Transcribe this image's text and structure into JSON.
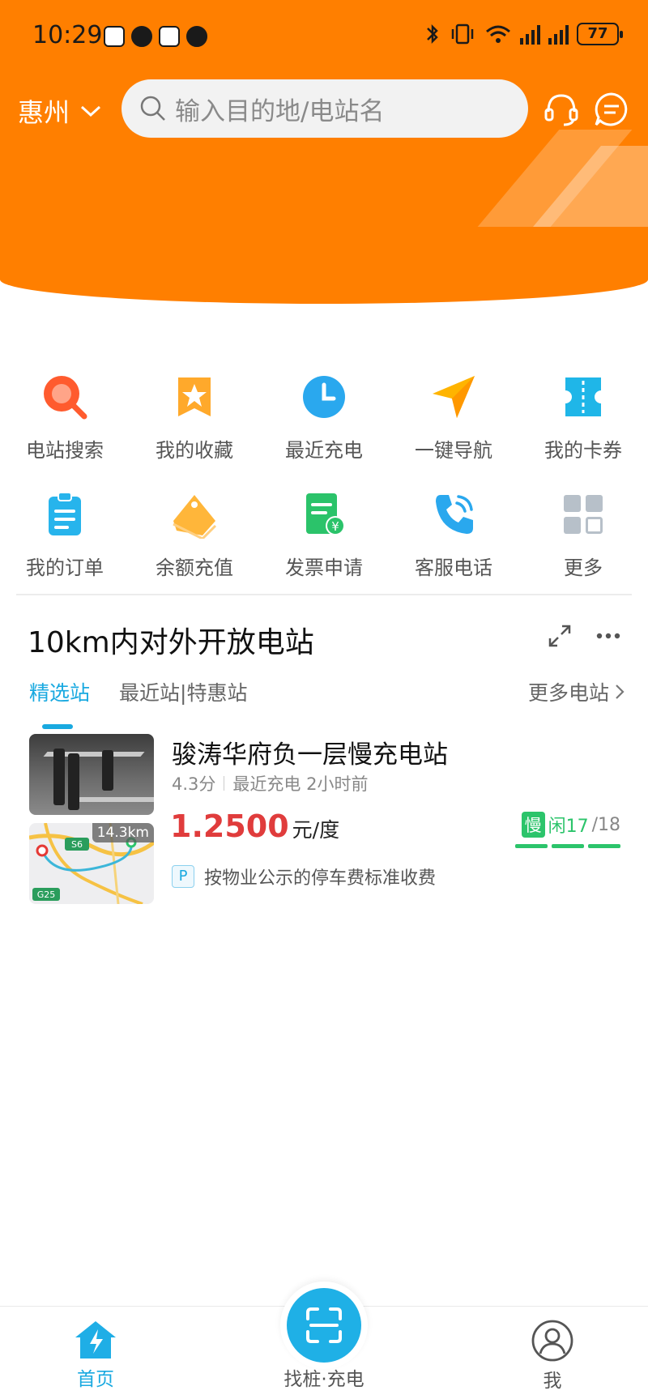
{
  "status_bar": {
    "time": "10:29",
    "battery": "77"
  },
  "header": {
    "city": "惠州",
    "search_placeholder": "输入目的地/电站名"
  },
  "quick_menu": [
    {
      "label": "电站搜索",
      "icon": "search-icon",
      "color": "#ff5b2e"
    },
    {
      "label": "我的收藏",
      "icon": "star-icon",
      "color": "#ffa92b"
    },
    {
      "label": "最近充电",
      "icon": "clock-icon",
      "color": "#2aa8ee"
    },
    {
      "label": "一键导航",
      "icon": "navigate-icon",
      "color": "#ffb400"
    },
    {
      "label": "我的卡券",
      "icon": "ticket-icon",
      "color": "#1fb6e8"
    },
    {
      "label": "我的订单",
      "icon": "clipboard-icon",
      "color": "#27b4ec"
    },
    {
      "label": "余额充值",
      "icon": "tag-icon",
      "color": "#ffb63a"
    },
    {
      "label": "发票申请",
      "icon": "invoice-icon",
      "color": "#2bc36a"
    },
    {
      "label": "客服电话",
      "icon": "phone-icon",
      "color": "#2aa8ee"
    },
    {
      "label": "更多",
      "icon": "grid-icon",
      "color": "#b7c0c9"
    }
  ],
  "section": {
    "title": "10km内对外开放电站",
    "tabs": [
      "精选站",
      "最近站|特惠站"
    ],
    "more_label": "更多电站"
  },
  "station": {
    "name": "骏涛华府负一层慢充电站",
    "rating": "4.3分",
    "last_charge": "最近充电 2小时前",
    "price": "1.2500",
    "price_unit": "元/度",
    "distance": "14.3km",
    "map_labels": [
      "S6",
      "G25"
    ],
    "slow_badge": "慢",
    "idle_label": "闲17",
    "total": "/18",
    "parking_badge": "P",
    "parking_text": "按物业公示的停车费标准收费"
  },
  "bottom_nav": {
    "home": "首页",
    "scan": "找桩·充电",
    "me": "我"
  },
  "colors": {
    "brand_orange": "#ff7f00",
    "accent_blue": "#19a9e0",
    "price_red": "#e03c3c",
    "idle_green": "#2cc46b"
  }
}
